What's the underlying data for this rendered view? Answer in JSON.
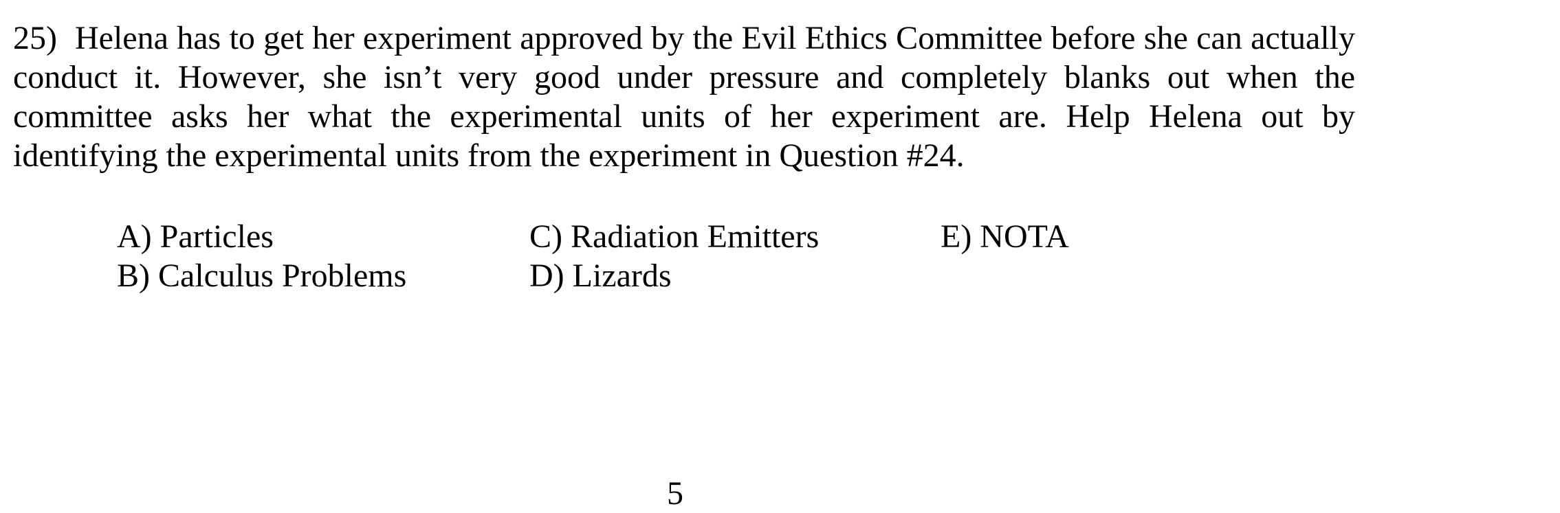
{
  "question": {
    "number": "25)",
    "text": "Helena has to get her experiment approved by the Evil Ethics Committee before she can actually conduct it.  However, she isn’t very good under pressure and completely blanks out when the committee asks her what the experimental units of her experiment are.  Help Helena out by identifying the experimental units from the experiment in Question #24."
  },
  "choices": {
    "a": "A) Particles",
    "b": "B) Calculus Problems",
    "c": "C) Radiation Emitters",
    "d": "D) Lizards",
    "e": "E) NOTA"
  },
  "page_number": "5"
}
